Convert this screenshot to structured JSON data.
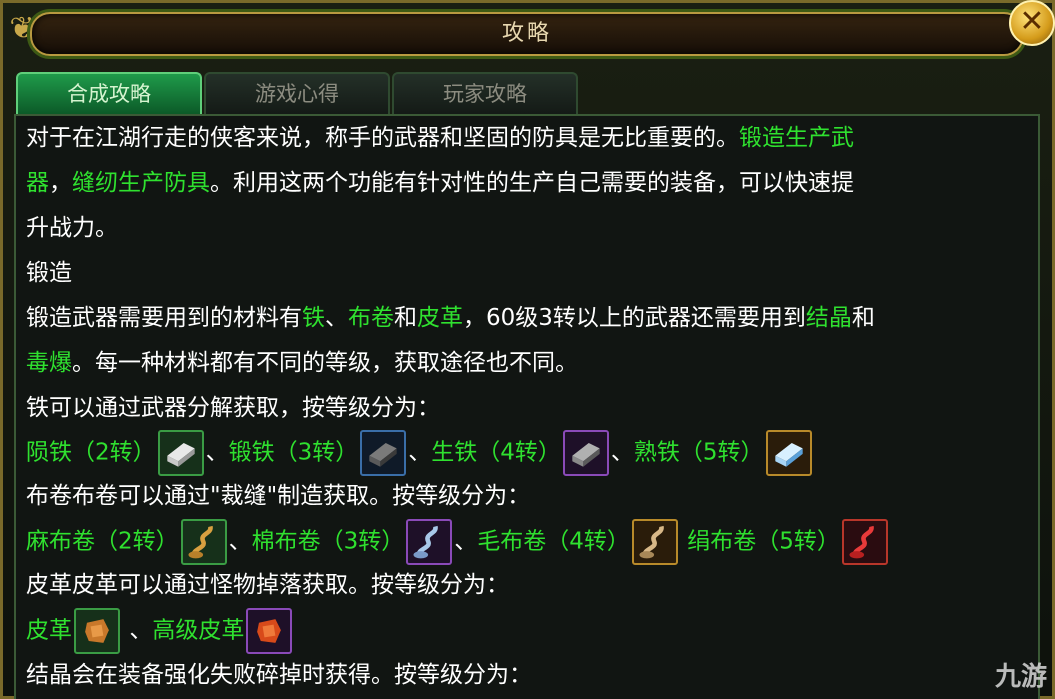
{
  "window": {
    "title": "攻略",
    "close_icon": "close-icon"
  },
  "tabs": [
    {
      "label": "合成攻略",
      "active": true
    },
    {
      "label": "游戏心得",
      "active": false
    },
    {
      "label": "玩家攻略",
      "active": false
    }
  ],
  "colors": {
    "highlight": "#2fe12f",
    "text": "#ffffff",
    "active_tab": "#1f9a4a"
  },
  "content": {
    "p1a": "对于在江湖行走的侠客来说，称手的武器和坚固的防具是无比重要的。",
    "p1b": "锻造生产武",
    "p2a": "器",
    "p2b": "，",
    "p2c": "缝纫生产防具",
    "p2d": "。利用这两个功能有针对性的生产自己需要的装备，可以快速提",
    "p3": "升战力。",
    "h_forge": "锻造",
    "p4a": "锻造武器需要用到的材料有",
    "p4b": "铁",
    "p4c": "、",
    "p4d": "布卷",
    "p4e": "和",
    "p4f": "皮革",
    "p4g": "，60级3转以上的武器还需要用到",
    "p4h": "结晶",
    "p4i": "和",
    "p5a": "毒爆",
    "p5b": "。每一种材料都有不同的等级，获取途径也不同。",
    "iron_intro": "铁可以通过武器分解获取，按等级分为：",
    "iron": [
      {
        "name": "陨铁（2转）",
        "icon": "iron-ingot-icon"
      },
      {
        "name": "锻铁（3转）",
        "icon": "iron-ingot-icon"
      },
      {
        "name": "生铁（4转）",
        "icon": "iron-ingot-icon"
      },
      {
        "name": "熟铁（5转）",
        "icon": "iron-ingot-icon"
      }
    ],
    "sep": "、",
    "cloth_intro": "布卷布卷可以通过\"裁缝\"制造获取。按等级分为：",
    "cloth": [
      {
        "name": "麻布卷（2转）",
        "icon": "cloth-roll-icon"
      },
      {
        "name": "棉布卷（3转）",
        "icon": "cloth-roll-icon"
      },
      {
        "name": "毛布卷（4转）",
        "icon": "cloth-roll-icon"
      },
      {
        "name": "绢布卷（5转）",
        "icon": "cloth-roll-icon"
      }
    ],
    "leather_intro": "皮革皮革可以通过怪物掉落获取。按等级分为：",
    "leather": [
      {
        "name": "皮革",
        "icon": "leather-icon"
      },
      {
        "name": "高级皮革",
        "icon": "leather-icon"
      }
    ],
    "crystal_intro": "结晶会在装备强化失败碎掉时获得。按等级分为："
  },
  "watermark": "九游"
}
